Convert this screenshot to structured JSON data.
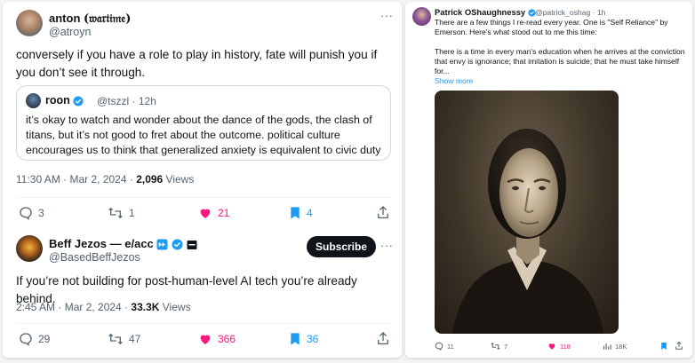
{
  "tweet1": {
    "display_name": "anton",
    "name_suffix": "(𝔴𝔞𝔯𝔱𝔦𝔪𝔢)",
    "handle": "@atroyn",
    "text": "conversely if you have a role to play in history, fate will punish you if you don’t see it through.",
    "quote": {
      "name": "roon",
      "handle": "@tszzl",
      "time": "· 12h",
      "text": "it’s okay to watch and wonder about the dance of the gods, the clash of titans, but it’s not good to fret about the outcome. political culture encourages us to think that generalized anxiety is equivalent to civic duty"
    },
    "timestamp": "11:30 AM · Mar 2, 2024 · ",
    "views_count": "2,096",
    "views_label": " Views",
    "replies": "3",
    "reposts": "1",
    "likes": "21",
    "bookmarks": "4"
  },
  "tweet2": {
    "display_name": "Beff Jezos — e/acc",
    "handle": "@BasedBeffJezos",
    "subscribe_label": "Subscribe",
    "text": "If you’re not building for post-human-level AI tech you’re already behind.",
    "timestamp": "2:45 AM · Mar 2, 2024 · ",
    "views_count": "33.3K",
    "views_label": " Views",
    "replies": "29",
    "reposts": "47",
    "likes": "366",
    "bookmarks": "36"
  },
  "tweet3": {
    "display_name": "Patrick OShaughnessy",
    "handle": "@patrick_oshag",
    "time": "· 1h",
    "text_line1": "There are a few things I re-read every year. One is \"Self Reliance\" by Emerson. Here's what stood out to me this time:",
    "text_line2": "There is a time in every man's education when he arrives at the conviction that envy is ignorance; that imitation is suicide; that he must take himself for...",
    "show_more": "Show more",
    "replies": "11",
    "reposts": "7",
    "likes": "118",
    "views": "18K"
  },
  "colors": {
    "accent": "#1d9bf0",
    "like": "#f91880",
    "muted": "#536471",
    "verified": "#1d9bf0"
  }
}
